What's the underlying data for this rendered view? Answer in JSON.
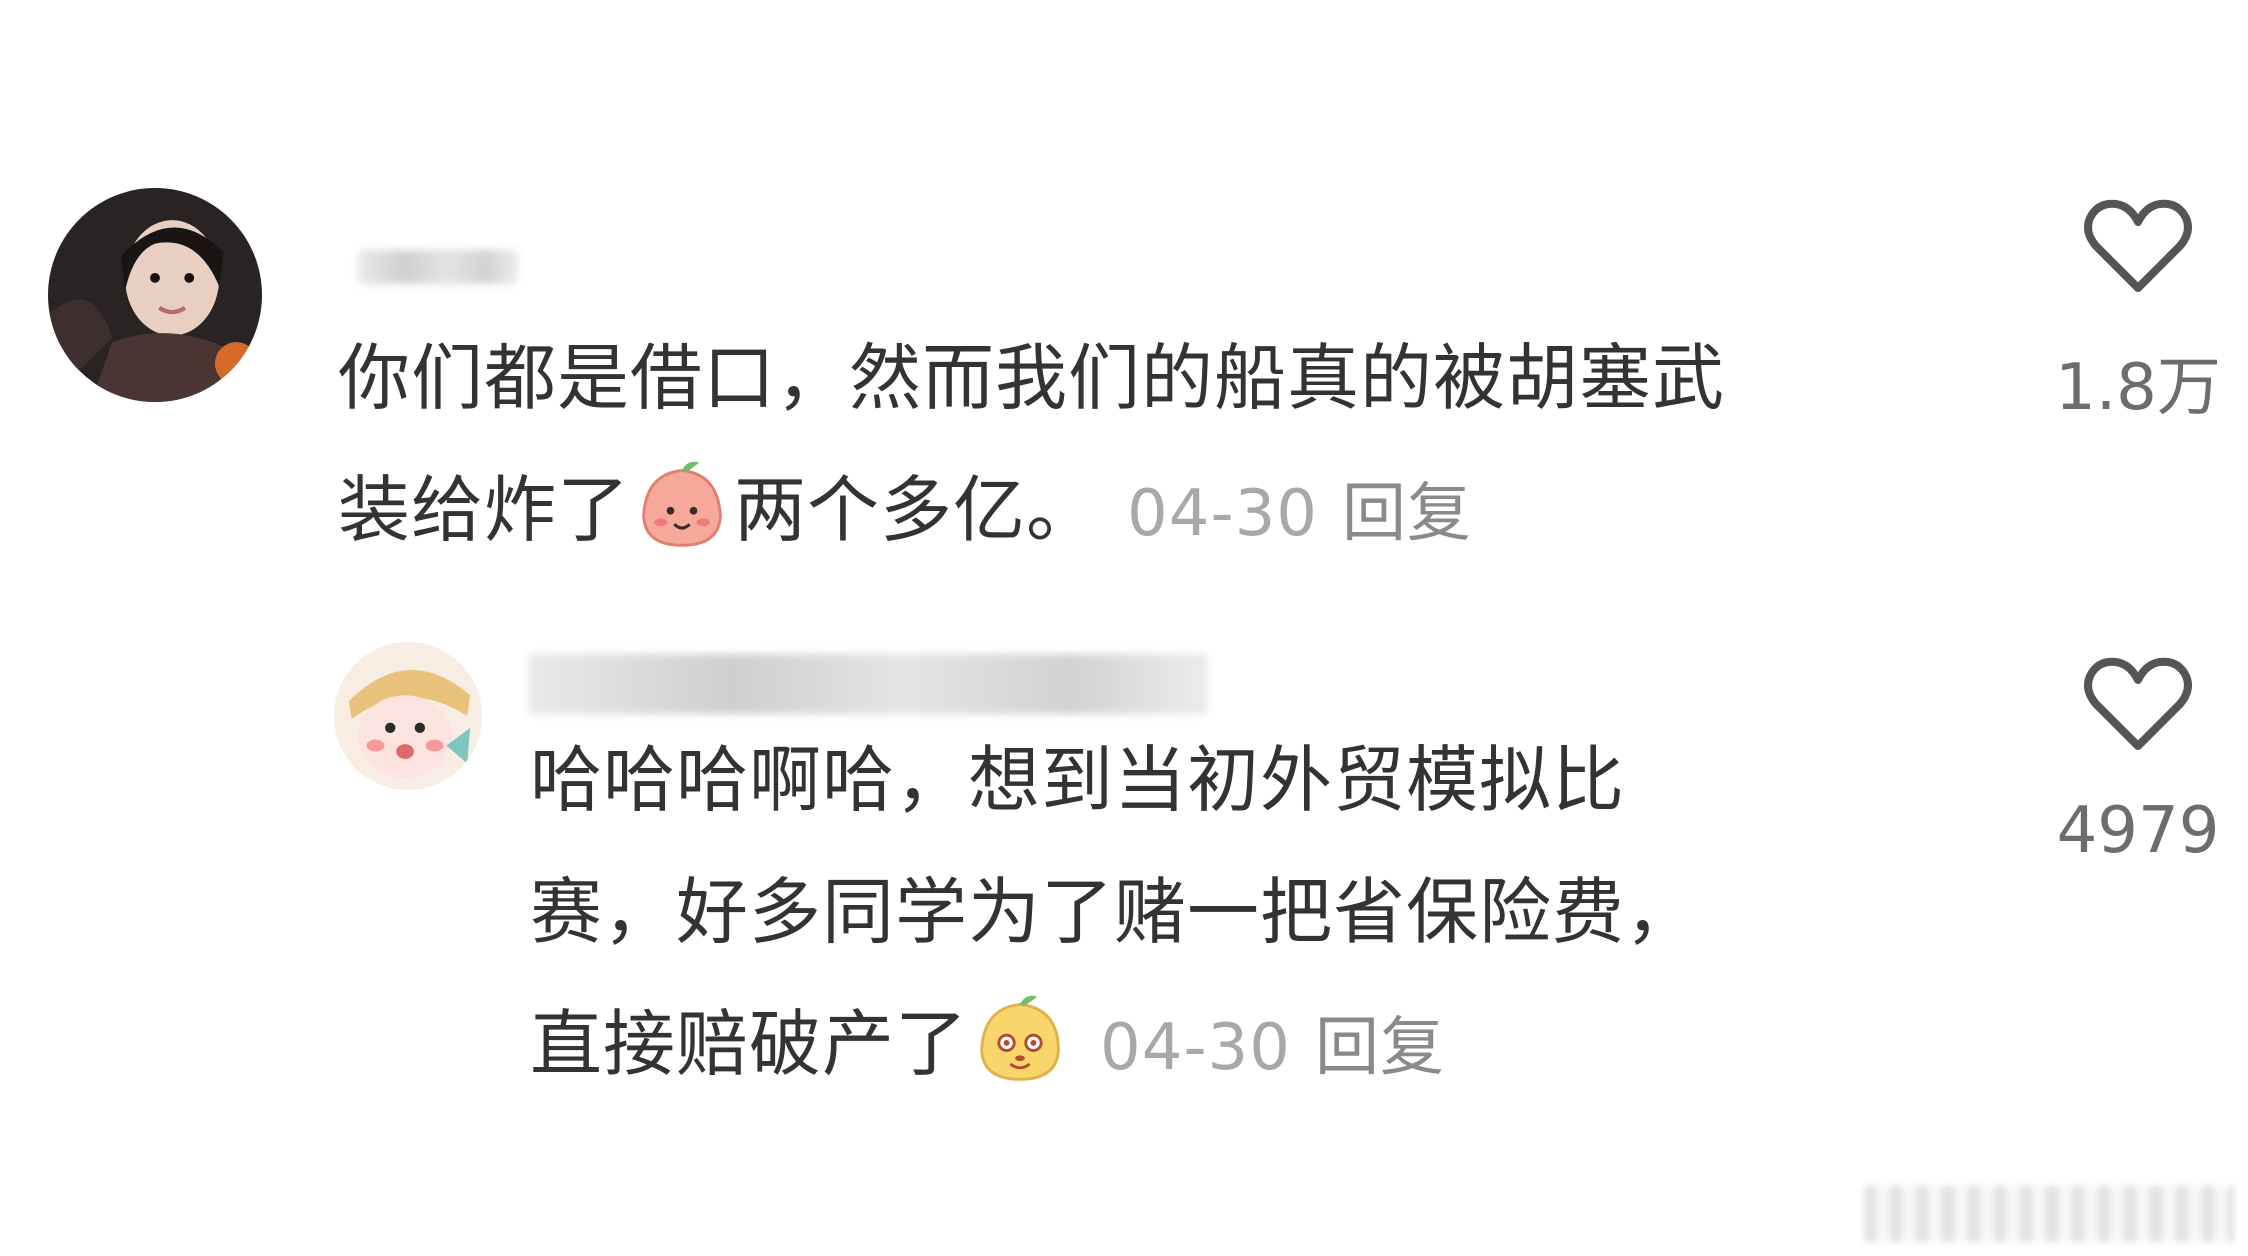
{
  "comments": [
    {
      "text_line1": "你们都是借口，然而我们的船真的被胡塞武",
      "text_line2_a": "装给炸了",
      "text_line2_b": "两个多亿。",
      "date": "04-30",
      "reply_label": "回复",
      "likes": "1.8万",
      "emoji_icon": "peach-smile-emoji-icon"
    },
    {
      "text_line1": "哈哈哈啊哈，想到当初外贸模拟比",
      "text_line2": "赛，好多同学为了赌一把省保险费，",
      "text_line3_a": "直接赔破产了",
      "date": "04-30",
      "reply_label": "回复",
      "likes": "4979",
      "emoji_icon": "cheeky-face-emoji-icon"
    }
  ],
  "colors": {
    "text": "#333333",
    "meta": "#a8a8a8",
    "like_count": "#6d6d6d",
    "heart_stroke": "#555555"
  }
}
